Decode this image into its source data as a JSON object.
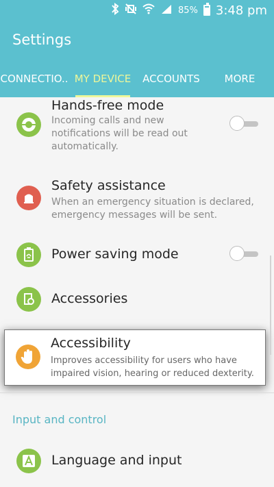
{
  "status_bar": {
    "battery": "85%",
    "time": "3:48 pm",
    "icons": [
      "bluetooth-icon",
      "vibrate-mute-icon",
      "wifi-icon",
      "signal-icon",
      "battery-icon"
    ]
  },
  "header": {
    "title": "Settings",
    "tabs": [
      {
        "label": "CONNECTIO..",
        "active": false
      },
      {
        "label": "MY DEVICE",
        "active": true
      },
      {
        "label": "ACCOUNTS",
        "active": false
      },
      {
        "label": "MORE",
        "active": false
      }
    ]
  },
  "items": {
    "handsfree": {
      "title": "Hands-free mode",
      "desc_lines": [
        "Incoming calls and new",
        "notifications will be read out",
        "automatically."
      ],
      "icon": "steering-wheel-icon",
      "color": "#8bc34a",
      "toggle": "off"
    },
    "safety": {
      "title": "Safety assistance",
      "desc_lines": [
        "When an emergency situation is declared,",
        "emergency messages will be sent."
      ],
      "icon": "warning-light-icon",
      "color": "#e05f50"
    },
    "power": {
      "title": "Power saving mode",
      "icon": "battery-recycle-icon",
      "color": "#8bc34a",
      "toggle": "off"
    },
    "accessories": {
      "title": "Accessories",
      "icon": "accessory-device-icon",
      "color": "#8bc34a"
    },
    "accessibility": {
      "title": "Accessibility",
      "desc_lines": [
        "Improves accessibility for users who have",
        "impaired vision, hearing or reduced dexterity."
      ],
      "icon": "hand-icon",
      "color": "#f0a436"
    },
    "language": {
      "title": "Language and input",
      "icon": "letter-a-keyboard-icon",
      "color": "#8bc34a"
    }
  },
  "sections": {
    "input_control": "Input and control"
  },
  "colors": {
    "primary": "#5bc0cf",
    "tab_active": "#eef79a",
    "section_title": "#58b5c3"
  }
}
